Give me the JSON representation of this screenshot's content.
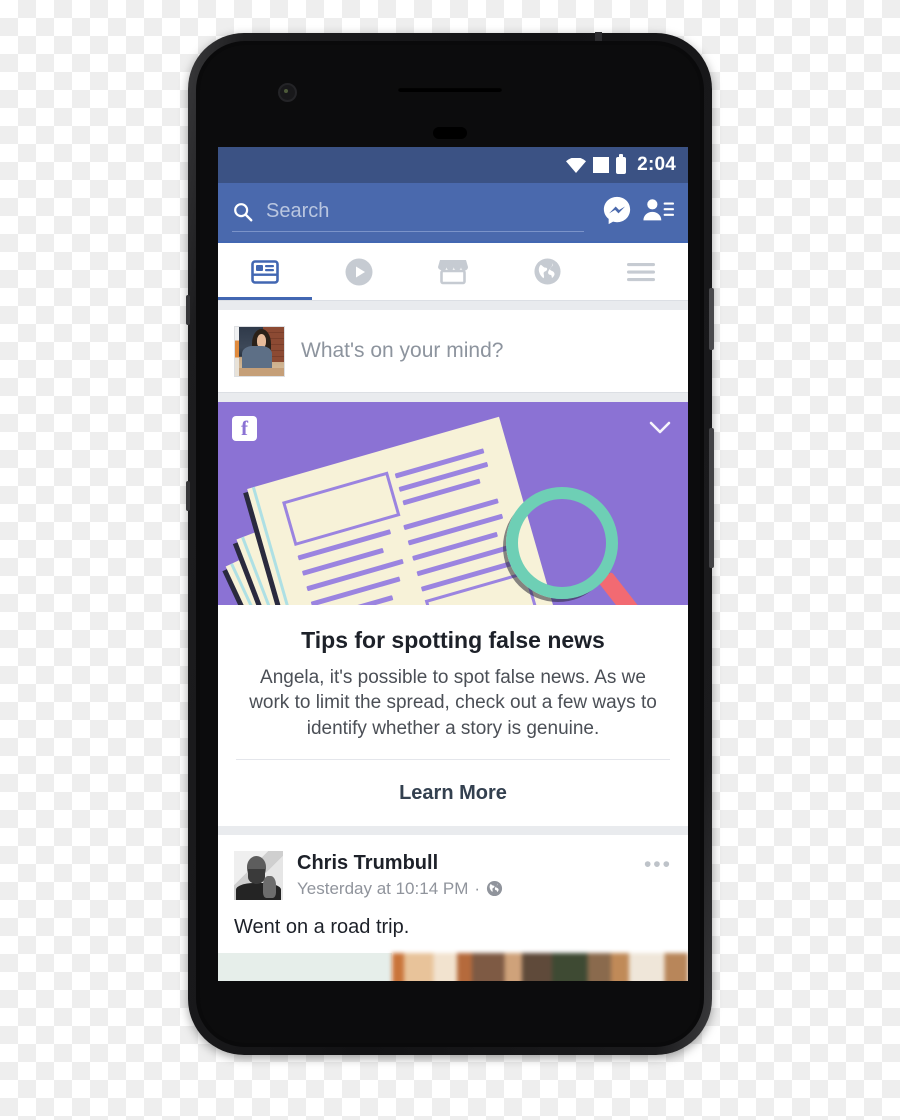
{
  "device": {
    "name": "android-smartphone",
    "camera_icon": "front-camera-icon",
    "speaker_icon": "earpiece-speaker-icon"
  },
  "status_bar": {
    "time": "2:04",
    "icons": [
      "wifi-icon",
      "cell-signal-icon",
      "battery-icon"
    ],
    "background": "#3b5284"
  },
  "header": {
    "background": "#4a69ad",
    "search": {
      "icon": "search-icon",
      "placeholder": "Search",
      "value": ""
    },
    "messenger_icon": "messenger-icon",
    "friend_requests_icon": "friend-requests-icon"
  },
  "tabs": [
    {
      "name": "news-feed",
      "icon": "news-feed-icon",
      "active": true
    },
    {
      "name": "watch",
      "icon": "play-circle-icon",
      "active": false
    },
    {
      "name": "marketplace",
      "icon": "marketplace-store-icon",
      "active": false
    },
    {
      "name": "notifications",
      "icon": "globe-icon",
      "active": false
    },
    {
      "name": "menu",
      "icon": "hamburger-menu-icon",
      "active": false
    }
  ],
  "composer": {
    "avatar": "user-avatar-photo",
    "placeholder": "What's on your mind?"
  },
  "promo_card": {
    "brand_icon": "facebook-f-logo",
    "collapse_icon": "chevron-down-icon",
    "hero_illustration": "newspapers-with-magnifying-glass-illustration",
    "hero_background": "#8b72d4",
    "title": "Tips for spotting false news",
    "body": "Angela, it's possible to spot false news. As we work to limit the spread, check out a few ways to identify whether a story is genuine.",
    "cta_label": "Learn More"
  },
  "post": {
    "avatar": "chris-trumbull-avatar",
    "author": "Chris Trumbull",
    "timestamp": "Yesterday at 10:14 PM",
    "separator": "·",
    "privacy_icon": "public-globe-icon",
    "menu_icon": "overflow-menu-icon",
    "menu_label": "•••",
    "message": "Went on a road trip.",
    "attachment": "road-trip-photo"
  },
  "colors": {
    "fb_blue": "#4267b2",
    "status_blue": "#3b5284",
    "header_blue": "#4a69ad",
    "card_purple": "#8b72d4",
    "feed_bg": "#e9ebee",
    "text_primary": "#1d2129",
    "text_secondary": "#90949c"
  }
}
